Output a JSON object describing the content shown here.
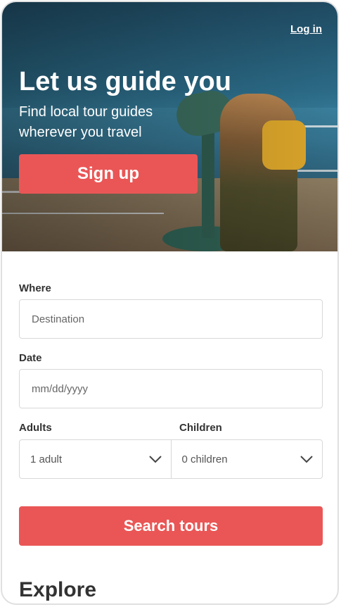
{
  "header": {
    "login_label": "Log in",
    "headline": "Let us guide you",
    "subline": "Find local tour guides wherever you travel",
    "signup_label": "Sign up"
  },
  "form": {
    "where": {
      "label": "Where",
      "placeholder": "Destination"
    },
    "date": {
      "label": "Date",
      "placeholder": "mm/dd/yyyy"
    },
    "adults": {
      "label": "Adults",
      "value": "1 adult"
    },
    "children": {
      "label": "Children",
      "value": "0 children"
    },
    "search_label": "Search tours"
  },
  "section": {
    "explore_title": "Explore"
  },
  "colors": {
    "accent": "#ea5656",
    "text": "#333333",
    "border": "#d8d8d8"
  },
  "icons": {
    "select_arrow": "chevron-down-icon"
  }
}
